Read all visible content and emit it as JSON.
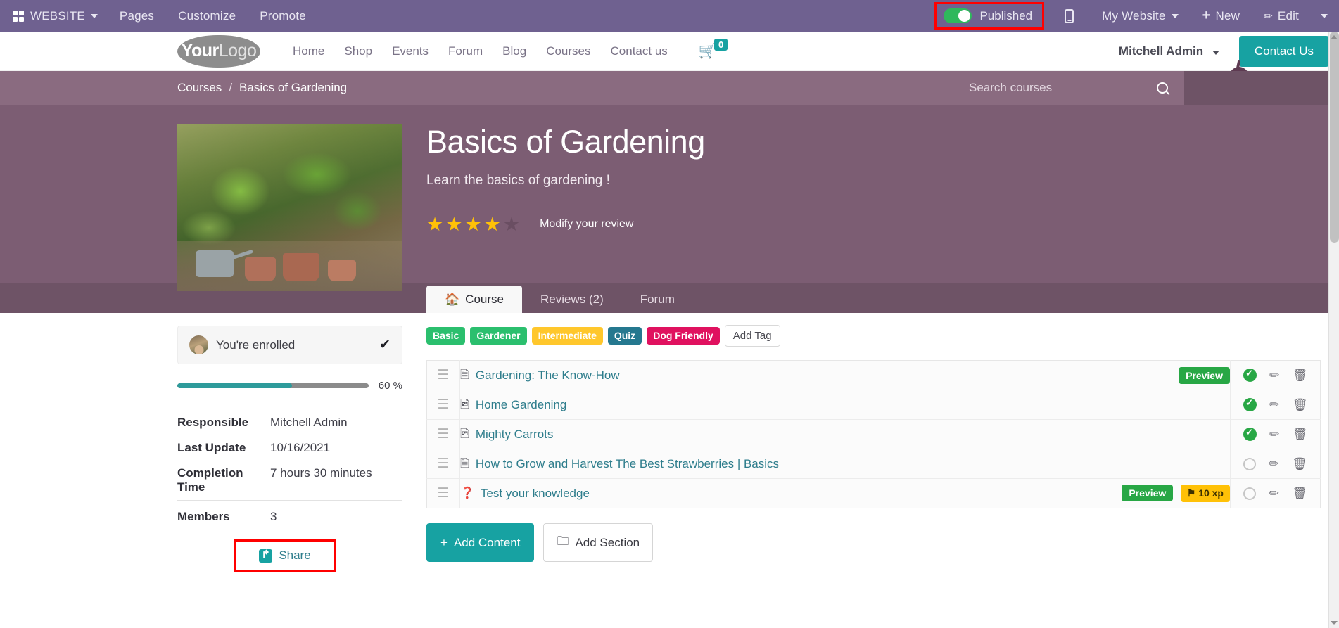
{
  "editor_bar": {
    "apps_icon": "grid-icon",
    "website_label": "WEBSITE",
    "items": [
      "Pages",
      "Customize",
      "Promote"
    ],
    "published_label": "Published",
    "published_state": "on",
    "published_color": "#2eb85c",
    "mobile_icon": "mobile-preview-icon",
    "my_website_label": "My Website",
    "new_label": "New",
    "edit_label": "Edit",
    "highlight_color": "#ff0000",
    "bar_color": "#6f6190"
  },
  "site_header": {
    "logo_part1": "Your",
    "logo_part2": "Logo",
    "nav": [
      "Home",
      "Shop",
      "Events",
      "Forum",
      "Blog",
      "Courses",
      "Contact us"
    ],
    "cart_icon": "shopping-cart-icon",
    "cart_count": "0",
    "cart_badge_color": "#17a2a2",
    "user_name": "Mitchell Admin",
    "contact_button": "Contact Us",
    "contact_button_color": "#17a2a2"
  },
  "breadcrumb": {
    "root": "Courses",
    "separator": "/",
    "current": "Basics of Gardening",
    "band_color": "#8a6b80"
  },
  "search": {
    "placeholder": "Search courses",
    "value": "",
    "icon": "search-icon"
  },
  "hero": {
    "title": "Basics of Gardening",
    "subtitle": "Learn the basics of gardening !",
    "image_alt": "gardening-course-thumbnail",
    "rating_filled": 4,
    "rating_total": 5,
    "star_color": "#ffc107",
    "modify_review_label": "Modify your review",
    "background_color": "#7c5d73"
  },
  "tabs": [
    {
      "label": "Course",
      "icon": "home-icon",
      "active": true
    },
    {
      "label": "Reviews (2)",
      "icon": "",
      "active": false
    },
    {
      "label": "Forum",
      "icon": "",
      "active": false
    }
  ],
  "sidebar": {
    "enrolled_label": "You're enrolled",
    "enrolled_icon": "check-icon",
    "avatar": "user-avatar",
    "progress_percent": 60,
    "progress_label": "60 %",
    "progress_color": "#2e9b9b",
    "meta": [
      {
        "key": "Responsible",
        "value": "Mitchell Admin",
        "separator": false
      },
      {
        "key": "Last Update",
        "value": "10/16/2021",
        "separator": false
      },
      {
        "key": "Completion Time",
        "value": "7 hours 30 minutes",
        "separator": false
      },
      {
        "key": "Members",
        "value": "3",
        "separator": true
      }
    ],
    "share_label": "Share",
    "share_icon": "share-icon",
    "share_highlight_color": "#ff0000"
  },
  "tags": [
    {
      "label": "Basic",
      "color": "#2bbf6e"
    },
    {
      "label": "Gardener",
      "color": "#2bbf6e"
    },
    {
      "label": "Intermediate",
      "color": "#ffc72c"
    },
    {
      "label": "Quiz",
      "color": "#25788f"
    },
    {
      "label": "Dog Friendly",
      "color": "#e0115f"
    }
  ],
  "add_tag_label": "Add Tag",
  "content_rows": [
    {
      "handle": "drag-handle",
      "type_icon": "pdf-file-icon",
      "title": "Gardening: The Know-How",
      "preview": "Preview",
      "xp": "",
      "status": "done"
    },
    {
      "handle": "drag-handle",
      "type_icon": "image-file-icon",
      "title": "Home Gardening",
      "preview": "",
      "xp": "",
      "status": "done"
    },
    {
      "handle": "drag-handle",
      "type_icon": "image-file-icon",
      "title": "Mighty Carrots",
      "preview": "",
      "xp": "",
      "status": "done"
    },
    {
      "handle": "drag-handle",
      "type_icon": "document-file-icon",
      "title": "How to Grow and Harvest The Best Strawberries | Basics",
      "preview": "",
      "xp": "",
      "status": "open"
    },
    {
      "handle": "drag-handle",
      "type_icon": "quiz-question-icon",
      "title": "Test your knowledge",
      "preview": "Preview",
      "xp": "10 xp",
      "status": "open"
    }
  ],
  "actions": {
    "edit_icon": "pencil-icon",
    "delete_icon": "trash-icon",
    "done_icon": "check-circle-icon",
    "open_icon": "empty-circle-icon"
  },
  "footer_buttons": {
    "add_content": "Add Content",
    "add_section": "Add Section",
    "add_content_color": "#17a2a2"
  }
}
